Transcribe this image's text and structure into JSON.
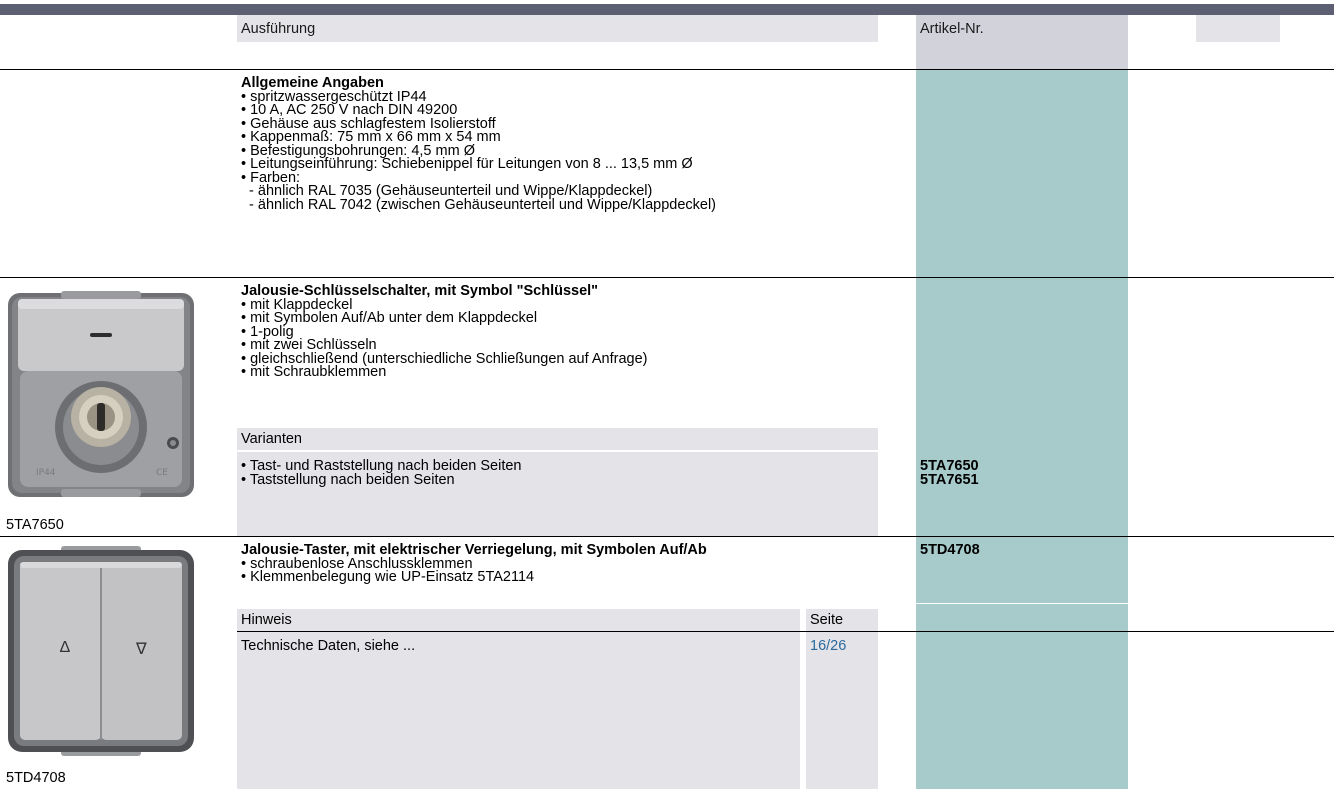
{
  "header": {
    "col_ausfuehrung": "Ausführung",
    "col_artikel": "Artikel-Nr."
  },
  "allgemein": {
    "title": "Allgemeine Angaben",
    "items": [
      "• spritzwassergeschützt IP44",
      "• 10 A, AC 250 V nach DIN 49200",
      "• Gehäuse aus schlagfestem Isolierstoff",
      "• Kappenmaß: 75 mm x 66 mm x 54 mm",
      "• Befestigungsbohrungen: 4,5 mm Ø",
      "• Leitungseinführung: Schiebenippel für Leitungen von 8 ... 13,5 mm Ø",
      "• Farben:",
      "  - ähnlich RAL 7035 (Gehäuseunterteil und Wippe/Klappdeckel)",
      "  - ähnlich RAL 7042 (zwischen Gehäuseunterteil und Wippe/Klappdeckel)"
    ]
  },
  "schluessel": {
    "title": "Jalousie-Schlüsselschalter, mit Symbol \"Schlüssel\"",
    "items": [
      "• mit Klappdeckel",
      "• mit Symbolen Auf/Ab unter dem Klappdeckel",
      "• 1-polig",
      "• mit zwei Schlüsseln",
      "• gleichschließend (unterschiedliche Schließungen auf Anfrage)",
      "• mit Schraubklemmen"
    ],
    "varianten_label": "Varianten",
    "variants": [
      {
        "text": "• Tast- und Raststellung nach beiden Seiten",
        "code": "5TA7650"
      },
      {
        "text": "• Taststellung nach beiden Seiten",
        "code": "5TA7651"
      }
    ],
    "image_caption": "5TA7650"
  },
  "taster": {
    "title": "Jalousie-Taster, mit elektrischer Verriegelung, mit Symbolen Auf/Ab",
    "code": "5TD4708",
    "items": [
      "• schraubenlose Anschlussklemmen",
      "• Klemmenbelegung wie UP-Einsatz 5TA2114"
    ],
    "hinweis_label": "Hinweis",
    "seite_label": "Seite",
    "technische_daten": "Technische Daten, siehe ...",
    "seite_ref": "16/26",
    "image_caption": "5TD4708",
    "arrow_up": "∆",
    "arrow_down": "∇"
  },
  "colors": {
    "topbar": "#5d6072",
    "header_gray": "#e3e3e8",
    "artikel_header": "#d2d2da",
    "teal": "#a7cacb",
    "link": "#2a6a9e"
  }
}
